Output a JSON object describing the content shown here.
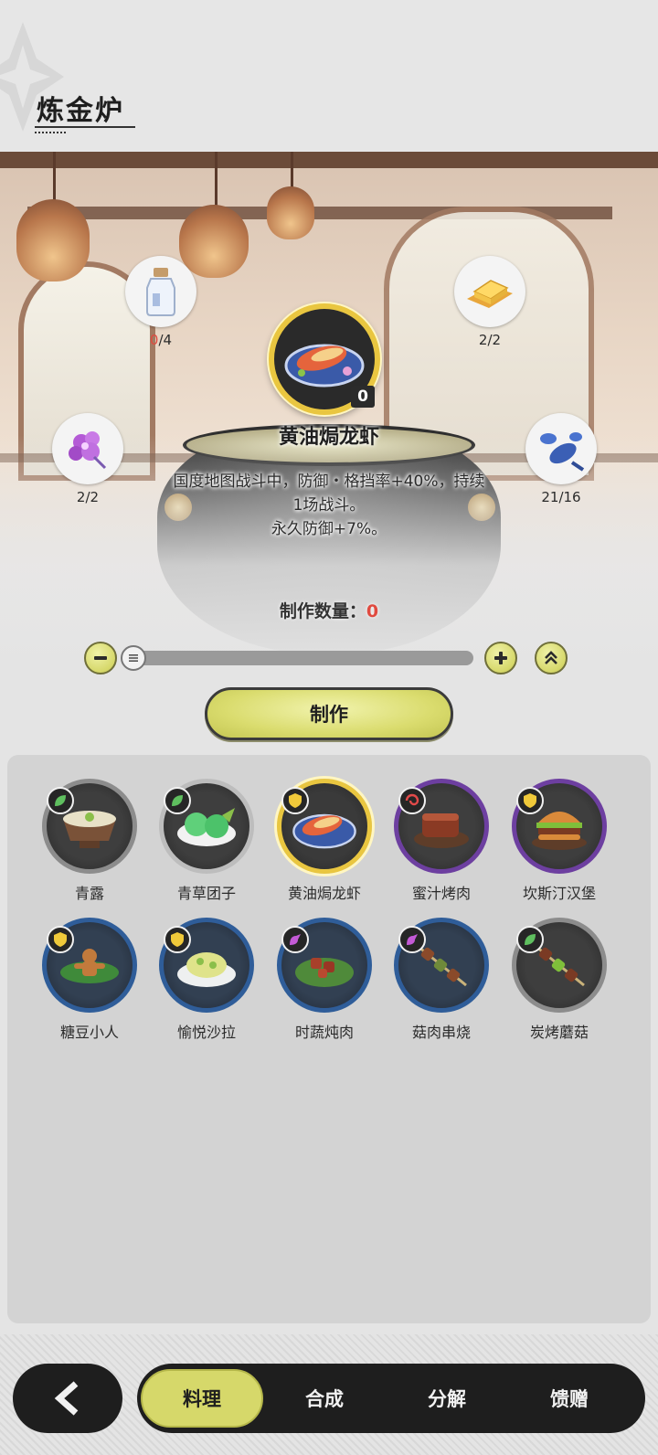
{
  "header": {
    "title": "炼金炉"
  },
  "ingredients": [
    {
      "icon": "milk-bottle-icon",
      "have": "0",
      "need": "4"
    },
    {
      "icon": "butter-icon",
      "count": "2/2"
    },
    {
      "icon": "purple-flower-icon",
      "count": "2/2"
    },
    {
      "icon": "lobster-icon",
      "count": "21/16"
    }
  ],
  "featured": {
    "name": "黄油焗龙虾",
    "owned": "0",
    "desc_line1": "国度地图战斗中，防御・格挡率+40%，持续",
    "desc_line2": "1场战斗。",
    "desc_line3": "永久防御+7%。"
  },
  "craft": {
    "count_label": "制作数量：",
    "count_value": "0",
    "button_label": "制作"
  },
  "recipes": [
    {
      "name": "青露",
      "badge": "leaf-icon",
      "ring": "gray"
    },
    {
      "name": "青草团子",
      "badge": "leaf-icon",
      "ring": "gray"
    },
    {
      "name": "黄油焗龙虾",
      "badge": "shield-icon",
      "ring": "selected"
    },
    {
      "name": "蜜汁烤肉",
      "badge": "spiral-icon",
      "ring": "purple"
    },
    {
      "name": "坎斯汀汉堡",
      "badge": "shield-icon",
      "ring": "purple"
    },
    {
      "name": "糖豆小人",
      "badge": "shield-icon",
      "ring": "blue"
    },
    {
      "name": "愉悦沙拉",
      "badge": "shield-icon",
      "ring": "blue"
    },
    {
      "name": "时蔬炖肉",
      "badge": "wave-icon",
      "ring": "blue"
    },
    {
      "name": "菇肉串烧",
      "badge": "wave-icon",
      "ring": "blue"
    },
    {
      "name": "炭烤蘑菇",
      "badge": "leaf-icon",
      "ring": "gray"
    }
  ],
  "tabs": [
    {
      "label": "料理",
      "active": true
    },
    {
      "label": "合成"
    },
    {
      "label": "分解"
    },
    {
      "label": "馈赠"
    }
  ],
  "colors": {
    "accent": "#d6d86a",
    "highlight": "#e9c640",
    "warning": "#e04a3f"
  }
}
